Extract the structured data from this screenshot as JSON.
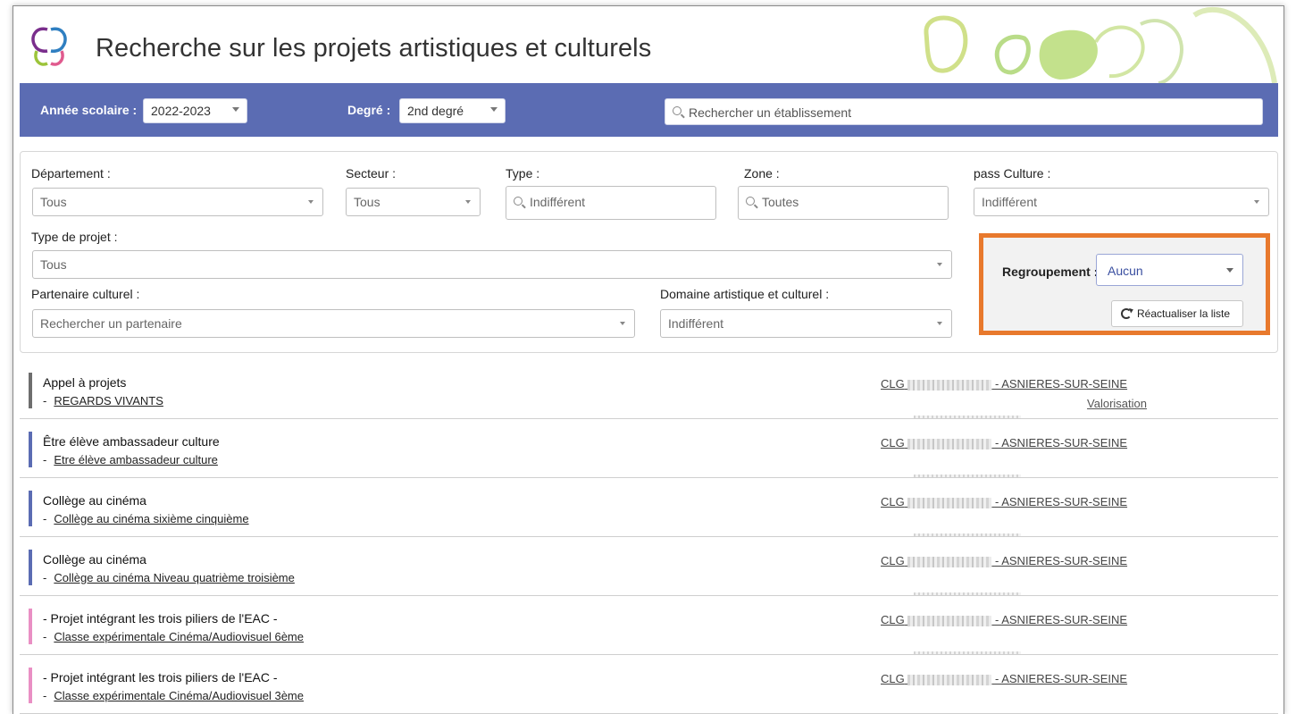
{
  "header": {
    "title": "Recherche sur les projets artistiques et culturels"
  },
  "bluebar": {
    "annee_label": "Année scolaire :",
    "annee_value": "2022-2023",
    "degre_label": "Degré :",
    "degre_value": "2nd degré",
    "search_placeholder": "Rechercher un établissement"
  },
  "filters": {
    "departement_label": "Département :",
    "departement_value": "Tous",
    "secteur_label": "Secteur :",
    "secteur_value": "Tous",
    "type_label": "Type :",
    "type_placeholder": "Indifférent",
    "zone_label": "Zone :",
    "zone_placeholder": "Toutes",
    "pass_label": "pass Culture :",
    "pass_value": "Indifférent",
    "type_projet_label": "Type de projet :",
    "type_projet_value": "Tous",
    "partenaire_label": "Partenaire culturel :",
    "partenaire_placeholder": "Rechercher un partenaire",
    "domaine_label": "Domaine artistique et culturel :",
    "domaine_value": "Indifférent"
  },
  "regroupement": {
    "label": "Regroupement :",
    "value": "Aucun",
    "refresh_label": "Réactualiser la liste"
  },
  "results": [
    {
      "title": "Appel à projets",
      "dash": "-",
      "link": "REGARDS VIVANTS",
      "etab_prefix": "CLG",
      "etab_city": "- ASNIERES-SUR-SEINE",
      "extra": "Valorisation",
      "color": "#6e6e6e"
    },
    {
      "title": "Être élève ambassadeur culture",
      "dash": "-",
      "link": "Etre élève ambassadeur culture",
      "etab_prefix": "CLG",
      "etab_city": "- ASNIERES-SUR-SEINE",
      "extra": "",
      "color": "#5b6cb3"
    },
    {
      "title": "Collège au cinéma",
      "dash": "-",
      "link": "Collège au cinéma sixième cinquième",
      "etab_prefix": "CLG",
      "etab_city": "- ASNIERES-SUR-SEINE",
      "extra": "",
      "color": "#5b6cb3"
    },
    {
      "title": "Collège au cinéma",
      "dash": "-",
      "link": "Collège au cinéma Niveau quatrième troisième",
      "etab_prefix": "CLG",
      "etab_city": "- ASNIERES-SUR-SEINE",
      "extra": "",
      "color": "#5b6cb3"
    },
    {
      "title": "- Projet intégrant les trois piliers de l'EAC -",
      "dash": "-",
      "link": "Classe expérimentale Cinéma/Audiovisuel 6ème",
      "etab_prefix": "CLG",
      "etab_city": "- ASNIERES-SUR-SEINE",
      "extra": "",
      "color": "#e98fc4"
    },
    {
      "title": "- Projet intégrant les trois piliers de l'EAC -",
      "dash": "-",
      "link": "Classe expérimentale Cinéma/Audiovisuel 3ème",
      "etab_prefix": "CLG",
      "etab_city": "- ASNIERES-SUR-SEINE",
      "extra": "",
      "color": "#e98fc4"
    }
  ],
  "colors": {
    "bluebar": "#5b6cb3",
    "highlight": "#e8792d",
    "logo_purple": "#7a2e8c",
    "logo_green": "#9cc43a"
  }
}
